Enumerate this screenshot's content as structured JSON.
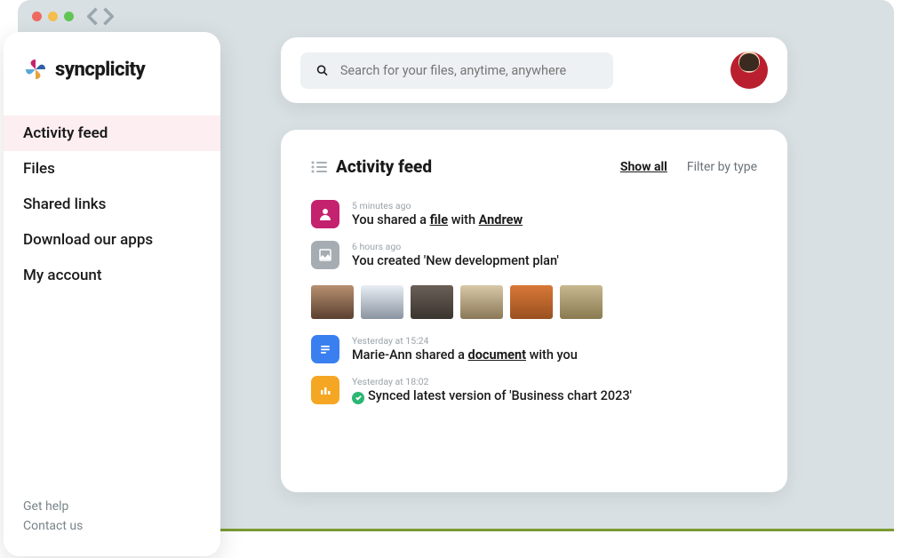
{
  "brand": {
    "name": "syncplicity"
  },
  "sidebar": {
    "items": [
      {
        "label": "Activity feed",
        "active": true
      },
      {
        "label": "Files",
        "active": false
      },
      {
        "label": "Shared links",
        "active": false
      },
      {
        "label": "Download our apps",
        "active": false
      },
      {
        "label": "My account",
        "active": false
      }
    ],
    "footer": [
      {
        "label": "Get help"
      },
      {
        "label": "Contact us"
      }
    ]
  },
  "search": {
    "placeholder": "Search for your files, anytime, anywhere"
  },
  "feed": {
    "title": "Activity feed",
    "show_all": "Show all",
    "filter_label": "Filter by type",
    "items": [
      {
        "icon": "person-icon",
        "color": "pink",
        "time": "5 minutes ago",
        "parts": [
          "You shared a ",
          {
            "u": "file"
          },
          " with ",
          {
            "u": "Andrew"
          }
        ]
      },
      {
        "icon": "image-icon",
        "color": "gray",
        "time": "6 hours ago",
        "parts": [
          "You created 'New development plan'"
        ],
        "thumbs": 6
      },
      {
        "icon": "document-icon",
        "color": "blue",
        "time": "Yesterday at 15:24",
        "parts": [
          "Marie-Ann shared a ",
          {
            "u": "document"
          },
          " with you"
        ]
      },
      {
        "icon": "chart-icon",
        "color": "orange",
        "time": "Yesterday at 18:02",
        "check": true,
        "parts": [
          "Synced latest version of 'Business chart 2023'"
        ]
      }
    ]
  }
}
